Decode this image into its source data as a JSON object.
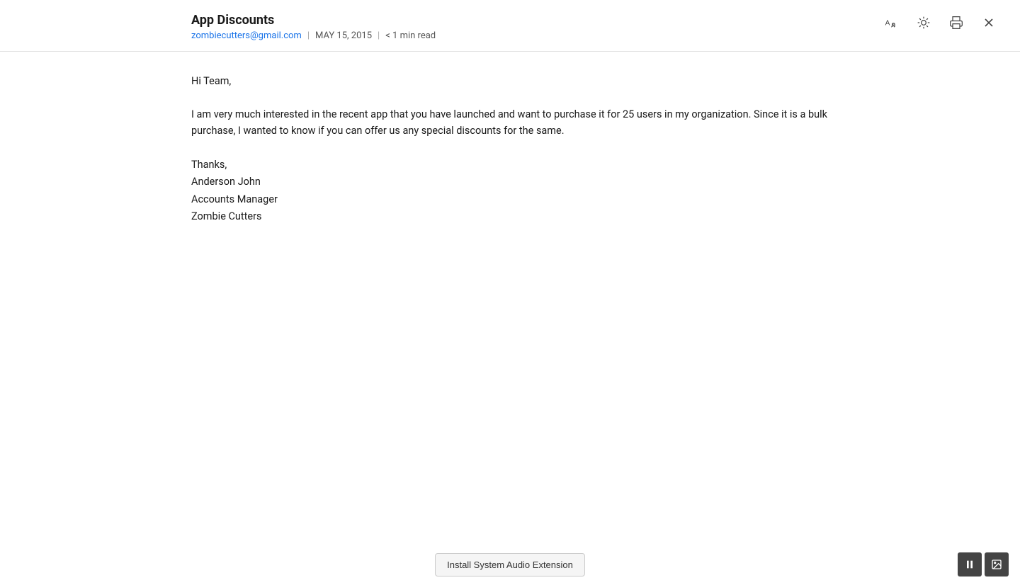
{
  "header": {
    "title": "App Discounts",
    "from_email": "zombiecutters@gmail.com",
    "date": "MAY 15, 2015",
    "read_time": "< 1 min read",
    "separator": "|"
  },
  "body": {
    "greeting": "Hi Team,",
    "paragraph": "I am very much interested in the recent app that you have launched and want to purchase it for 25 users in my organization. Since it is a bulk purchase, I wanted to know if you can offer us any special discounts for the same.",
    "closing": "Thanks,",
    "name": "Anderson John",
    "title": "Accounts Manager",
    "company": "Zombie Cutters"
  },
  "footer": {
    "install_button": "Install System Audio Extension"
  },
  "icons": {
    "font_size": "Aa",
    "brightness": "☀",
    "print": "🖨",
    "close": "✕"
  }
}
